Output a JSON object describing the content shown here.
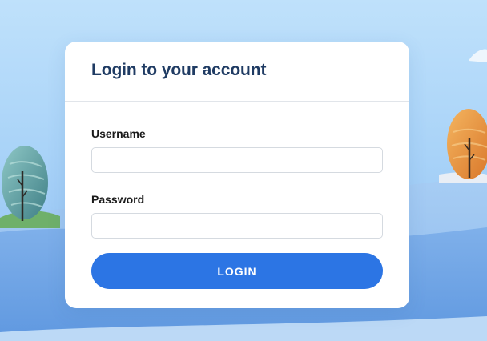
{
  "login": {
    "title": "Login to your account",
    "username_label": "Username",
    "username_value": "",
    "password_label": "Password",
    "password_value": "",
    "submit_label": "LOGIN"
  },
  "colors": {
    "accent": "#2c75e4",
    "title": "#1f3b63",
    "sky_top": "#bfe1fb",
    "sky_bottom": "#8cbdf1",
    "card": "#ffffff"
  },
  "background": {
    "elements": [
      "left-tree-icon",
      "right-tree-icon",
      "hills"
    ]
  }
}
